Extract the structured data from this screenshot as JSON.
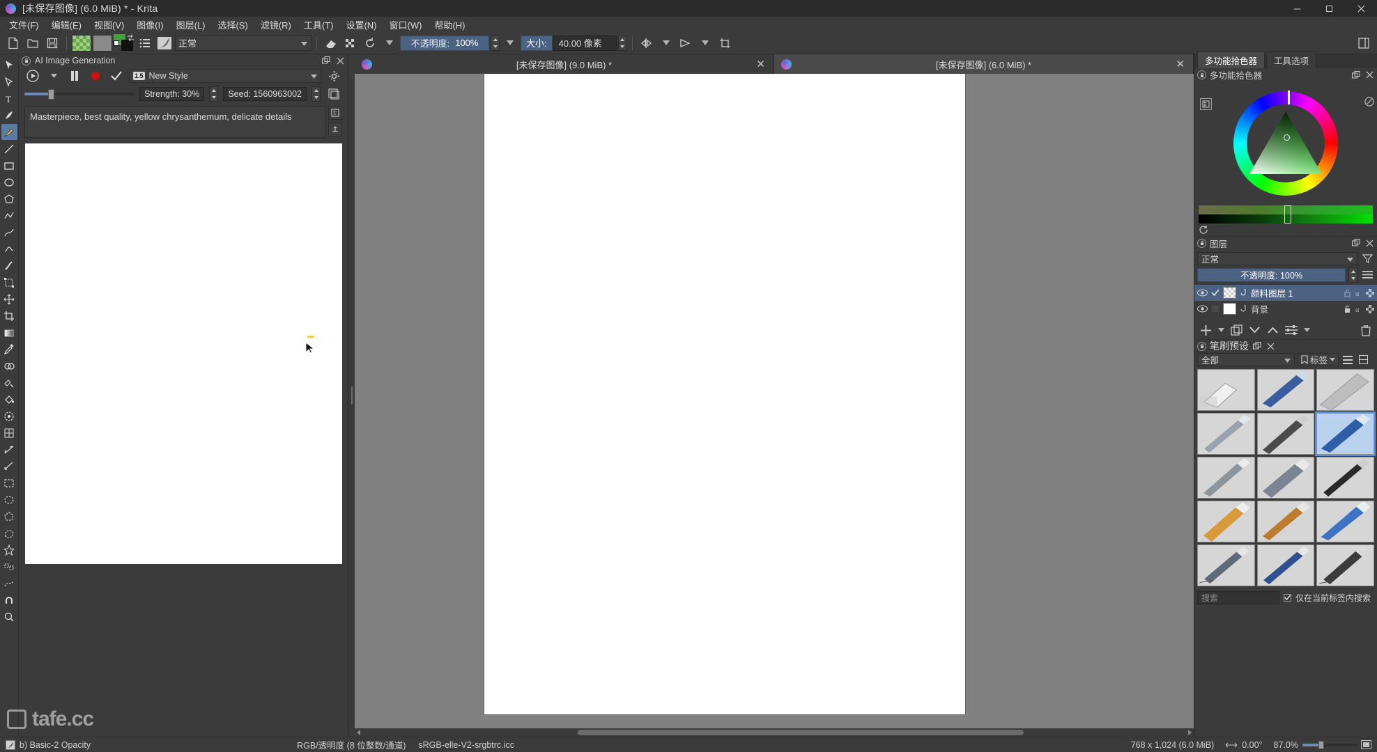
{
  "window": {
    "title": "[未保存图像]  (6.0 MiB) * - Krita",
    "minimize": "−",
    "maximize": "□",
    "close": "✕"
  },
  "menubar": {
    "items": [
      {
        "label": "文件(F)"
      },
      {
        "label": "编辑(E)"
      },
      {
        "label": "视图(V)"
      },
      {
        "label": "图像(I)"
      },
      {
        "label": "图层(L)"
      },
      {
        "label": "选择(S)"
      },
      {
        "label": "滤镜(R)"
      },
      {
        "label": "工具(T)"
      },
      {
        "label": "设置(N)"
      },
      {
        "label": "窗口(W)"
      },
      {
        "label": "帮助(H)"
      }
    ]
  },
  "toolbar": {
    "new_icon": "new-document-icon",
    "open_icon": "open-folder-icon",
    "save_icon": "save-disk-icon",
    "pattern_icon": "pattern-swatch",
    "gradient_icon": "gradient-swatch",
    "fgbg_icon": "foreground-background-color",
    "presets_icon": "brush-presets-list-icon",
    "editbrush_icon": "edit-brush-settings-icon",
    "blend_mode": "正常",
    "eraser_icon": "eraser-toggle-icon",
    "alpha_icon": "preserve-alpha-icon",
    "reset_icon": "reset-rotation-icon",
    "opacity_label": "不透明度:",
    "opacity_value": "100%",
    "size_label": "大小:",
    "size_value": "40.00 像素",
    "mirror_h_icon": "mirror-horizontal-icon",
    "mirror_v_icon": "mirror-vertical-icon",
    "wrap_icon": "wrap-around-icon",
    "overflow_icon": "toolbar-overflow-icon"
  },
  "tools": {
    "items": [
      {
        "name": "tool-transform",
        "icon": "transform-arrow-icon"
      },
      {
        "name": "tool-select-shapes",
        "icon": "select-shapes-icon"
      },
      {
        "name": "tool-text",
        "icon": "text-tool-icon"
      },
      {
        "name": "tool-calligraphy",
        "icon": "calligraphy-icon"
      },
      {
        "name": "tool-freehand-brush",
        "icon": "freehand-brush-icon",
        "active": true
      },
      {
        "name": "tool-line",
        "icon": "line-icon"
      },
      {
        "name": "tool-rectangle",
        "icon": "rectangle-icon"
      },
      {
        "name": "tool-ellipse",
        "icon": "ellipse-icon"
      },
      {
        "name": "tool-polygon",
        "icon": "polygon-icon"
      },
      {
        "name": "tool-polyline",
        "icon": "polyline-icon"
      },
      {
        "name": "tool-bezier-curve",
        "icon": "bezier-curve-icon"
      },
      {
        "name": "tool-freehand-path",
        "icon": "freehand-path-icon"
      },
      {
        "name": "tool-dynamic-brush",
        "icon": "dynamic-brush-icon"
      },
      {
        "name": "tool-transform-layer",
        "icon": "transform-layer-icon"
      },
      {
        "name": "tool-move",
        "icon": "move-icon"
      },
      {
        "name": "tool-crop",
        "icon": "crop-icon"
      },
      {
        "name": "tool-gradient",
        "icon": "gradient-tool-icon"
      },
      {
        "name": "tool-color-sampler",
        "icon": "color-sampler-icon"
      },
      {
        "name": "tool-colorize-mask",
        "icon": "colorize-mask-icon"
      },
      {
        "name": "tool-smart-patch",
        "icon": "smart-patch-icon"
      },
      {
        "name": "tool-fill",
        "icon": "fill-bucket-icon"
      },
      {
        "name": "tool-enclose-fill",
        "icon": "enclose-fill-icon"
      },
      {
        "name": "tool-gradient-mesh",
        "icon": "gradient-mesh-icon"
      },
      {
        "name": "tool-assistant",
        "icon": "assistant-icon"
      },
      {
        "name": "tool-measure",
        "icon": "measure-icon"
      },
      {
        "name": "tool-rect-select",
        "icon": "rectangular-selection-icon"
      },
      {
        "name": "tool-elliptical-select",
        "icon": "elliptical-selection-icon"
      },
      {
        "name": "tool-polygonal-select",
        "icon": "polygonal-selection-icon"
      },
      {
        "name": "tool-freehand-select",
        "icon": "freehand-selection-icon"
      },
      {
        "name": "tool-contiguous-select",
        "icon": "contiguous-selection-icon"
      },
      {
        "name": "tool-similar-select",
        "icon": "similar-color-selection-icon"
      },
      {
        "name": "tool-bezier-select",
        "icon": "bezier-selection-icon"
      },
      {
        "name": "tool-magnetic-select",
        "icon": "magnetic-selection-icon"
      },
      {
        "name": "tool-zoom",
        "icon": "zoom-tool-icon"
      }
    ]
  },
  "ai_panel": {
    "title": "AI Image Generation",
    "float_icon": "float-docker-icon",
    "close_icon": "close-docker-icon",
    "generate_icon": "generate-play-icon",
    "generate_menu_icon": "chevron-down-icon",
    "pause_icon": "pause-icon",
    "record_icon": "record-stop-icon",
    "apply_icon": "apply-check-icon",
    "style_badge": "1.5",
    "style_name": "New Style",
    "settings_icon": "settings-gear-icon",
    "layer_icon": "add-layer-icon",
    "strength_label": "Strength: 30%",
    "strength_percent": 30,
    "seed_label": "Seed: 1560963002",
    "prompt": "Masterpiece, best quality, yellow chrysanthemum, delicate details",
    "prompt_tool_icon": "text-options-icon",
    "prompt_add_icon": "add-prompt-icon"
  },
  "documents": {
    "tabs": [
      {
        "label": "[未保存图像]  (9.0 MiB) *",
        "active": false,
        "close": "✕"
      },
      {
        "label": "[未保存图像]  (6.0 MiB) *",
        "active": true,
        "close": "✕"
      }
    ]
  },
  "right_dock": {
    "tabs": [
      {
        "label": "多功能拾色器",
        "active": true
      },
      {
        "label": "工具选项",
        "active": false
      }
    ],
    "color_selector": {
      "title": "多功能拾色器",
      "lock_icon": "docker-lock-icon",
      "float_icon": "float-docker-icon",
      "close_icon": "close-docker-icon",
      "options_icon": "selector-options-icon",
      "clear_icon": "clear-color-history-icon",
      "reset_icon": "reset-color-icon"
    },
    "layers": {
      "title": "图层",
      "lock_icon": "docker-lock-icon",
      "float_icon": "float-docker-icon",
      "close_icon": "close-docker-icon",
      "blend_mode": "正常",
      "filter_icon": "layer-filter-icon",
      "opacity_label": "不透明度: 100%",
      "menu_icon": "layer-properties-menu-icon",
      "items": [
        {
          "name": "颜料图层 1",
          "selected": true,
          "visible": true,
          "checked": true,
          "thumb": "transparent",
          "locked": false
        },
        {
          "name": "背景",
          "selected": false,
          "visible": true,
          "checked": false,
          "thumb": "white",
          "locked": true
        }
      ],
      "toolbar": {
        "add_icon": "add-layer-icon",
        "add_menu_icon": "chevron-down-icon",
        "duplicate_icon": "duplicate-layer-icon",
        "down_icon": "move-layer-down-icon",
        "up_icon": "move-layer-up-icon",
        "properties_icon": "layer-properties-icon",
        "properties_menu_icon": "chevron-down-icon",
        "delete_icon": "delete-layer-icon"
      }
    },
    "brush_presets": {
      "title": "笔刷预设",
      "lock_icon": "docker-lock-icon",
      "float_icon": "float-docker-icon",
      "close_icon": "close-docker-icon",
      "filter_value": "全部",
      "tag_label": "标签",
      "list_icon": "list-view-icon",
      "grid_icon": "grid-view-icon",
      "search_placeholder": "搜索",
      "search_value": "",
      "scope_label": "仅在当前标签内搜索",
      "scope_checked": true,
      "presets": [
        {
          "name": "a-eraser-soft",
          "selected": false
        },
        {
          "name": "b-basic-1",
          "selected": false
        },
        {
          "name": "c-smudge-soft",
          "selected": false
        },
        {
          "name": "d-ink-pen",
          "selected": false
        },
        {
          "name": "e-pencil-soft",
          "selected": false
        },
        {
          "name": "f-basic-2-opacity",
          "selected": true
        },
        {
          "name": "g-ink-gpen",
          "selected": false
        },
        {
          "name": "h-marker",
          "selected": false
        },
        {
          "name": "i-charcoal",
          "selected": false
        },
        {
          "name": "j-airbrush",
          "selected": false
        },
        {
          "name": "k-bristles",
          "selected": false
        },
        {
          "name": "l-watercolor",
          "selected": false
        },
        {
          "name": "m-sketch",
          "selected": false
        },
        {
          "name": "n-ink-ballpen",
          "selected": false
        },
        {
          "name": "o-pencil-hard",
          "selected": false
        }
      ]
    }
  },
  "statusbar": {
    "preset_icon": "current-preset-icon",
    "preset_name": "b) Basic-2 Opacity",
    "color_model": "RGB/透明度 (8 位整数/通道)",
    "color_profile": "sRGB-elle-V2-srgbtrc.icc",
    "dimensions": "768 x 1,024 (6.0 MiB)",
    "rotation_icon": "canvas-rotation-icon",
    "rotation": "0.00°",
    "zoom": "87.0%",
    "zoom_percent": 87,
    "fit_icon": "fit-page-icon"
  },
  "watermark": {
    "text": "tafe.cc",
    "logo_icon": "square-logo-icon"
  },
  "colors": {
    "accent": "#4b6282",
    "panel_bg": "#3b3b3b",
    "dark_bg": "#2b2b2b",
    "canvas_bg": "#808080",
    "fg_color": "#3fa23f"
  }
}
